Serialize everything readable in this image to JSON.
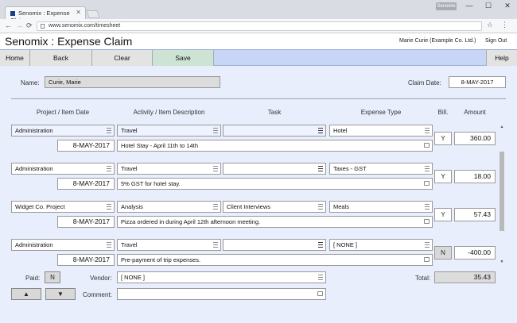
{
  "browser": {
    "tab_title": "Senomix : Expense Claim",
    "tab_close": "✕",
    "url": "www.senomix.com/timesheet",
    "profile": "Senomix",
    "back": "←",
    "forward": "→",
    "reload": "⟳",
    "minimize": "—",
    "maximize": "☐",
    "close": "✕",
    "star": "☆",
    "menu": "⋮"
  },
  "app": {
    "title": "Senomix : Expense Claim",
    "user": "Marie Curie   (Example Co. Ltd.)",
    "sign_out": "Sign Out"
  },
  "toolbar": {
    "home": "Home",
    "back": "Back",
    "clear": "Clear",
    "save": "Save",
    "help": "Help"
  },
  "form": {
    "name_label": "Name:",
    "name_value": "Curie, Marie",
    "claim_date_label": "Claim Date:",
    "claim_date_value": "8-MAY-2017",
    "headers": {
      "project": "Project / Item Date",
      "activity": "Activity / Item Description",
      "task": "Task",
      "expense_type": "Expense Type",
      "billable": "Bill.",
      "amount": "Amount"
    },
    "items": [
      {
        "project": "Administration",
        "activity": "Travel",
        "task": "",
        "expense_type": "Hotel",
        "date": "8-MAY-2017",
        "description": "Hotel Stay - April 11th to 14th",
        "billable": "Y",
        "amount": "360.00"
      },
      {
        "project": "Administration",
        "activity": "Travel",
        "task": "",
        "expense_type": "Taxes - GST",
        "date": "8-MAY-2017",
        "description": "5% GST for hotel stay.",
        "billable": "Y",
        "amount": "18.00"
      },
      {
        "project": "Widget Co. Project",
        "activity": "Analysis",
        "task": "Client Interviews",
        "expense_type": "Meals",
        "date": "8-MAY-2017",
        "description": "Pizza ordered in during April 12th afternoon meeting.",
        "billable": "Y",
        "amount": "57.43"
      },
      {
        "project": "Administration",
        "activity": "Travel",
        "task": "",
        "expense_type": "[ NONE ]",
        "date": "8-MAY-2017",
        "description": "Pre-payment of trip expenses.",
        "billable": "N",
        "amount": "-400.00"
      }
    ],
    "paid_label": "Paid:",
    "paid_value": "N",
    "vendor_label": "Vendor:",
    "vendor_value": "[ NONE ]",
    "total_label": "Total:",
    "total_value": "35.43",
    "comment_label": "Comment:",
    "comment_value": "",
    "up_arrow": "▲",
    "down_arrow": "▼",
    "scroll_up": "▲",
    "scroll_down": "▼"
  }
}
